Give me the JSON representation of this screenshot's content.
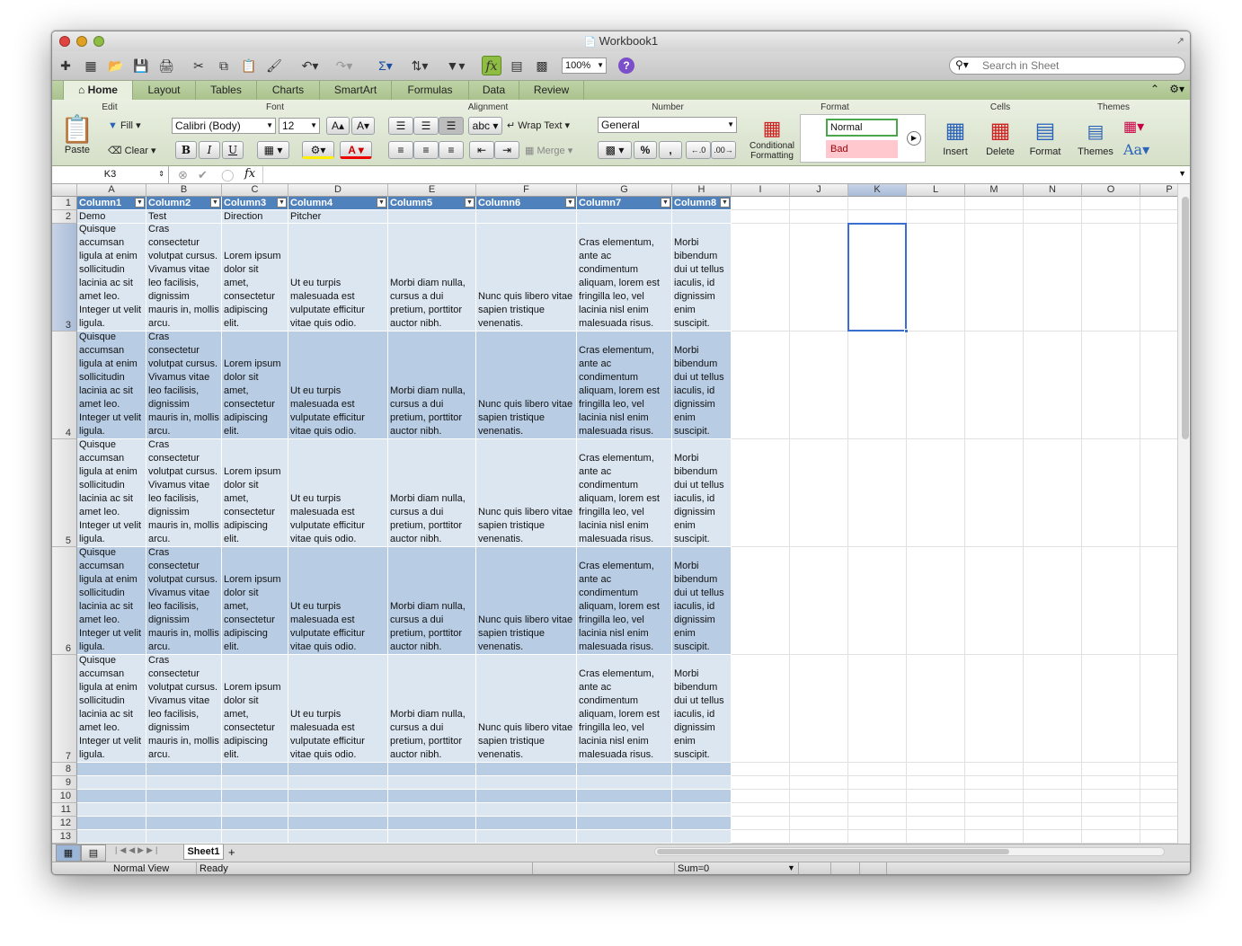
{
  "window": {
    "title": "Workbook1"
  },
  "toolbar": {
    "zoom": "100%",
    "search_placeholder": "Search in Sheet",
    "fx_label": "fx"
  },
  "ribbon_tabs": [
    "Home",
    "Layout",
    "Tables",
    "Charts",
    "SmartArt",
    "Formulas",
    "Data",
    "Review"
  ],
  "ribbon": {
    "groups": {
      "edit": "Edit",
      "font": "Font",
      "alignment": "Alignment",
      "number": "Number",
      "format": "Format",
      "cells": "Cells",
      "themes": "Themes"
    },
    "paste": "Paste",
    "fill": "Fill",
    "clear": "Clear",
    "font_name": "Calibri (Body)",
    "font_size": "12",
    "bold": "B",
    "italic": "I",
    "underline": "U",
    "abc": "abc",
    "wrap_text": "Wrap Text",
    "merge": "Merge",
    "number_format": "General",
    "percent": "%",
    "comma": ",",
    "conditional_formatting": "Conditional Formatting",
    "style_normal": "Normal",
    "style_bad": "Bad",
    "insert": "Insert",
    "delete": "Delete",
    "format": "Format",
    "themes": "Themes",
    "aa": "Aa"
  },
  "formula_bar": {
    "name_box": "K3",
    "fx": "fx",
    "value": ""
  },
  "columns": [
    "A",
    "B",
    "C",
    "D",
    "E",
    "F",
    "G",
    "H",
    "I",
    "J",
    "K",
    "L",
    "M",
    "N",
    "O",
    "P"
  ],
  "rows": [
    "1",
    "2",
    "3",
    "4",
    "5",
    "6",
    "7",
    "8",
    "9",
    "10",
    "11",
    "12",
    "13"
  ],
  "table": {
    "headers": [
      "Column1",
      "Column2",
      "Column3",
      "Column4",
      "Column5",
      "Column6",
      "Column7",
      "Column8"
    ],
    "row2": [
      "Demo",
      "Test",
      "Direction",
      "Pitcher",
      "",
      "",
      "",
      ""
    ],
    "body": [
      "Quisque accumsan ligula at enim sollicitudin lacinia ac sit amet leo. Integer ut velit ligula.",
      "Cras consectetur volutpat cursus. Vivamus vitae leo facilisis, dignissim mauris in, mollis arcu.",
      "Lorem ipsum dolor sit amet, consectetur adipiscing elit.",
      "Ut eu turpis malesuada est vulputate efficitur vitae quis odio.",
      "Morbi diam nulla, cursus a dui pretium, porttitor auctor nibh.",
      "Nunc quis libero vitae sapien tristique venenatis.",
      "Cras elementum, ante ac condimentum aliquam, lorem est fringilla leo, vel lacinia nisl enim malesuada risus.",
      "Morbi bibendum dui ut tellus iaculis, id dignissim enim suscipit."
    ]
  },
  "sheet_tabs": [
    "Sheet1"
  ],
  "status": {
    "view": "Normal View",
    "state": "Ready",
    "sum": "Sum=0"
  },
  "colors": {
    "header": "#4f81bd",
    "band_light": "#dce6f1",
    "band_dark": "#b8cce4",
    "ribbon": "#d5dfc8"
  }
}
